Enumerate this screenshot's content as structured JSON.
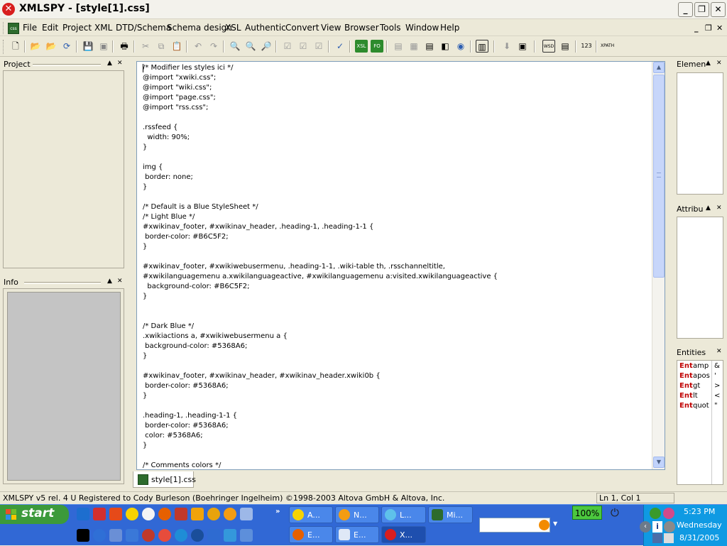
{
  "window": {
    "title": "XMLSPY - [style[1].css]",
    "icon": "close-circle-icon"
  },
  "menu": {
    "items": [
      "File",
      "Edit",
      "Project",
      "XML",
      "DTD/Schema",
      "Schema design",
      "XSL",
      "Authentic",
      "Convert",
      "View",
      "Browser",
      "Tools",
      "Window",
      "Help"
    ]
  },
  "panels": {
    "project": "Project",
    "info": "Info",
    "elements": "Elemen",
    "attributes": "Attribu",
    "entities": "Entities"
  },
  "entities": [
    {
      "tag": "Ent",
      "name": "amp",
      "char": "&"
    },
    {
      "tag": "Ent",
      "name": "apos",
      "char": "'"
    },
    {
      "tag": "Ent",
      "name": "gt",
      "char": ">"
    },
    {
      "tag": "Ent",
      "name": "lt",
      "char": "<"
    },
    {
      "tag": "Ent",
      "name": "quot",
      "char": "\""
    }
  ],
  "editor": {
    "code": "/* Modifier les styles ici */\n@import \"xwiki.css\";\n@import \"wiki.css\";\n@import \"page.css\";\n@import \"rss.css\";\n\n.rssfeed {\n  width: 90%;\n}\n\nimg {\n border: none;\n}\n\n/* Default is a Blue StyleSheet */\n/* Light Blue */\n#xwikinav_footer, #xwikinav_header, .heading-1, .heading-1-1 {\n border-color: #B6C5F2;\n}\n\n#xwikinav_footer, #xwikiwebusermenu, .heading-1-1, .wiki-table th, .rsschanneltitle,\n#xwikilanguagemenu a.xwikilanguageactive, #xwikilanguagemenu a:visited.xwikilanguageactive {\n  background-color: #B6C5F2;\n}\n\n\n/* Dark Blue */\n.xwikiactions a, #xwikiwebusermenu a {\n background-color: #5368A6;\n}\n\n#xwikinav_footer, #xwikinav_header, #xwikinav_header.xwiki0b {\n border-color: #5368A6;\n}\n\n.heading-1, .heading-1-1 {\n border-color: #5368A6;\n color: #5368A6;\n}\n\n/* Comments colors */",
    "tab_label": "style[1].css"
  },
  "status": {
    "message": "XMLSPY v5 rel. 4 U   Registered to Cody Burleson (Boehringer Ingelheim)   ©1998-2003 Altova GmbH & Altova, Inc.",
    "position": "Ln 1, Col 1"
  },
  "taskbar": {
    "start_label": "start",
    "tasks_row1": [
      "A...",
      "N...",
      "L...",
      "Mi..."
    ],
    "tasks_row2": [
      "E...",
      "E...",
      "X..."
    ],
    "battery": "100%",
    "clock_time": "5:23 PM",
    "clock_day": "Wednesday",
    "clock_date": "8/31/2005"
  },
  "colors": {
    "accent": "#3168d5",
    "editor_border": "#7f9db9",
    "entity_tag": "#c00000"
  }
}
